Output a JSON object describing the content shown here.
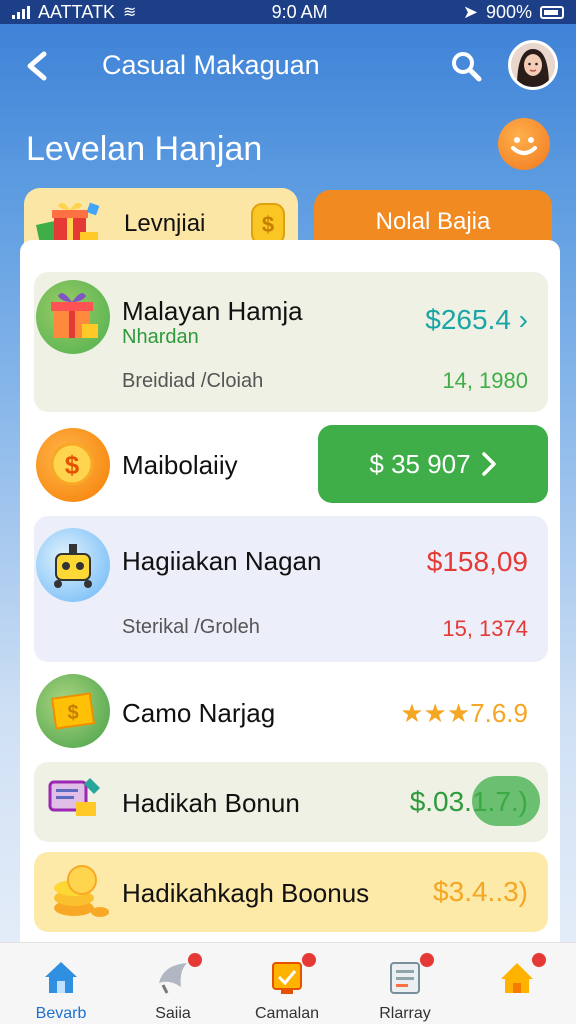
{
  "status": {
    "carrier": "AATTATK",
    "time": "9:0 AM",
    "battery": "900%"
  },
  "header": {
    "title": "Casual Makaguan",
    "back_icon": "chevron-left-icon",
    "search_icon": "search-icon"
  },
  "section": {
    "title": "Levelan Hanjan"
  },
  "tabs": {
    "left": "Levnjiai",
    "right": "Nolal Bajia"
  },
  "items": [
    {
      "name": "Malayan Hamja",
      "sub": "Nhardan",
      "meta": "Breidiad /Cloiah",
      "amount": "$265.4",
      "count": "14, 1980"
    },
    {
      "name": "Maibolaiiy",
      "amount": "$ 35 907"
    },
    {
      "name": "Hagiiakan Nagan",
      "meta": "Sterikal /Groleh",
      "amount": "$158,09",
      "count": "15, 1374"
    },
    {
      "name": "Camo Narjag",
      "amount": "★★★7.6.9"
    },
    {
      "name": "Hadikah Bonun",
      "amount": "$.03.1.7.)"
    },
    {
      "name": "Hadikahkagh Boonus",
      "amount": "$3.4..3)"
    }
  ],
  "nav": [
    {
      "label": "Bevarb",
      "icon": "home-icon",
      "active": true
    },
    {
      "label": "Saiia",
      "icon": "horn-icon"
    },
    {
      "label": "Camalan",
      "icon": "trophy-icon"
    },
    {
      "label": "Rlarray",
      "icon": "clipboard-icon"
    },
    {
      "label": "",
      "icon": "house-icon"
    }
  ],
  "colors": {
    "accent_blue": "#3b7fd6",
    "orange": "#f28a22",
    "green": "#3fae49",
    "teal": "#1aa6a6",
    "red": "#e53935"
  }
}
